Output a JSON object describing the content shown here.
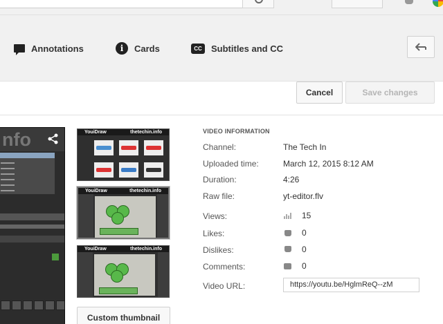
{
  "tabs": {
    "annotations": "Annotations",
    "cards": "Cards",
    "subtitles": "Subtitles and CC",
    "cc_badge": "CC",
    "cards_badge": "i"
  },
  "actions": {
    "cancel": "Cancel",
    "save": "Save changes"
  },
  "editor_preview": {
    "logo_text": "nfo",
    "share_glyph": "<"
  },
  "thumbnails": {
    "header_left": "YouiDraw",
    "header_right": "thetechin.info",
    "custom_button": "Custom thumbnail"
  },
  "video_info": {
    "heading": "VIDEO INFORMATION",
    "channel_label": "Channel:",
    "channel": "The Tech In",
    "uploaded_label": "Uploaded time:",
    "uploaded": "March 12, 2015 8:12 AM",
    "duration_label": "Duration:",
    "duration": "4:26",
    "raw_file_label": "Raw file:",
    "raw_file": "yt-editor.flv",
    "views_label": "Views:",
    "views": "15",
    "likes_label": "Likes:",
    "likes": "0",
    "dislikes_label": "Dislikes:",
    "dislikes": "0",
    "comments_label": "Comments:",
    "comments": "0",
    "url_label": "Video URL:",
    "url": "https://youtu.be/HglmReQ--zM"
  },
  "colors": {
    "background": "#f1f1f1",
    "save_disabled_text": "#b5b5b5",
    "clover_green": "#58b84a"
  },
  "icons": [
    "search-icon",
    "bell-icon",
    "annotation-icon",
    "info-icon",
    "cc-icon",
    "back-arrow-icon",
    "share-icon",
    "bar-chart-icon",
    "thumb-up-icon",
    "thumb-down-icon",
    "comment-icon"
  ]
}
